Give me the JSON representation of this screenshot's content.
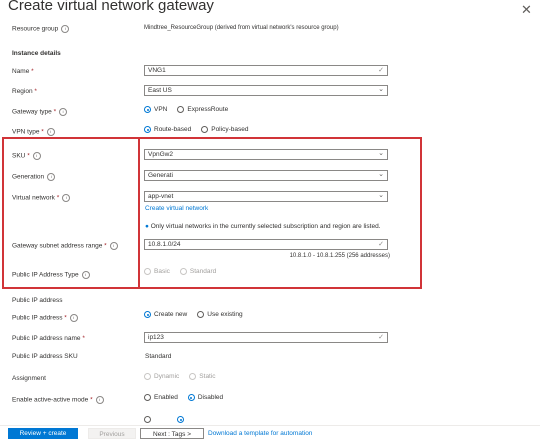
{
  "page_title": "Create virtual network gateway",
  "resource_group": {
    "label": "Resource group",
    "value": "Mindtree_ResourceGroup (derived from virtual network's resource group)"
  },
  "section_instance": "Instance details",
  "name": {
    "label": "Name",
    "value": "VNG1"
  },
  "region": {
    "label": "Region",
    "value": "East US"
  },
  "gateway_type": {
    "label": "Gateway type",
    "opt1": "VPN",
    "opt2": "ExpressRoute"
  },
  "vpn_type": {
    "label": "VPN type",
    "opt1": "Route-based",
    "opt2": "Policy-based"
  },
  "sku": {
    "label": "SKU",
    "value": "VpnGw2"
  },
  "generation": {
    "label": "Generation",
    "value": "Generati"
  },
  "virtual_network": {
    "label": "Virtual network",
    "value": "app-vnet",
    "create_link": "Create virtual network"
  },
  "info_note": "Only virtual networks in the currently selected subscription and region are listed.",
  "subnet": {
    "label": "Gateway subnet address range",
    "value": "10.8.1.0/24",
    "range": "10.8.1.0 - 10.8.1.255 (256 addresses)"
  },
  "public_ip_type": {
    "label": "Public IP Address Type",
    "opt1": "Basic",
    "opt2": "Standard"
  },
  "section_public_ip": "Public IP address",
  "public_ip": {
    "label": "Public IP address",
    "opt1": "Create new",
    "opt2": "Use existing"
  },
  "public_ip_name": {
    "label": "Public IP address name",
    "value": "ip123"
  },
  "public_ip_sku": {
    "label": "Public IP address SKU",
    "value": "Standard"
  },
  "assignment": {
    "label": "Assignment",
    "opt1": "Dynamic",
    "opt2": "Static"
  },
  "active_active": {
    "label": "Enable active-active mode",
    "opt1": "Enabled",
    "opt2": "Disabled"
  },
  "footer": {
    "review": "Review + create",
    "previous": "Previous",
    "next": "Next : Tags >",
    "template_link": "Download a template for automation"
  }
}
